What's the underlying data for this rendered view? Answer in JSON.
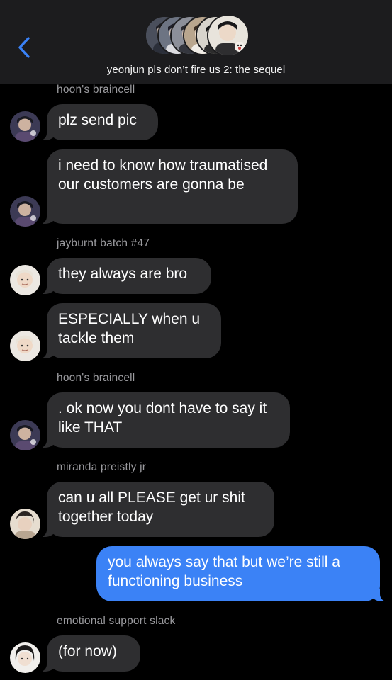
{
  "header": {
    "title": "yeonjun pls don’t fire us 2: the sequel",
    "back_icon": "chevron-left-icon",
    "accent": "#3a82f7"
  },
  "messages": [
    {
      "sender": "hoon's braincell",
      "text": "plz send pic",
      "avatar": "hoon-avatar"
    },
    {
      "text": "i need to know how traumatised our customers are gonna be",
      "avatar": "hoon-avatar"
    },
    {
      "sender": "jayburnt batch #47",
      "text": "they always are bro",
      "avatar": "jay-avatar"
    },
    {
      "text": "ESPECIALLY when u tackle them",
      "avatar": "jay-avatar"
    },
    {
      "sender": "hoon's braincell",
      "text": ". ok now you dont have to say it like THAT",
      "avatar": "hoon-avatar"
    },
    {
      "sender": "miranda preistly jr",
      "text": "can u all PLEASE get ur shit together today",
      "avatar": "miranda-avatar"
    },
    {
      "text": "you always say that but we’re still a functioning business",
      "outgoing": true
    },
    {
      "sender": "emotional support slack",
      "text": "(for now)",
      "avatar": "slack-avatar"
    }
  ],
  "colors": {
    "incoming_bubble": "#2e2e30",
    "outgoing_bubble": "#3b82f6",
    "sender_label": "#9a9a9e",
    "background": "#000000",
    "header_bg": "#1c1c1e"
  }
}
